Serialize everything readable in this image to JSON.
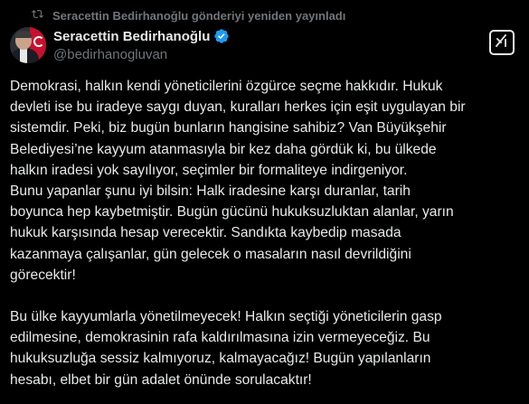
{
  "repost": {
    "icon": "repost-icon",
    "text": "Seracettin Bedirhanoğlu gönderiyi yeniden yayınladı"
  },
  "author": {
    "display_name": "Seracettin Bedirhanoğlu",
    "handle": "@bedirhanogluvan",
    "verified_icon": "verified-badge-icon",
    "verified_color": "#1d9bf0"
  },
  "actions": {
    "grok_icon": "grok-icon"
  },
  "post": {
    "paragraph1": "Demokrasi, halkın kendi yöneticilerini özgürce seçme hakkıdır. Hukuk\ndevleti ise bu iradeye saygı duyan, kuralları herkes için eşit uygulayan bir\nsistemdir. Peki, biz bugün bunların hangisine sahibiz? Van Büyükşehir\nBelediyesi’ne kayyum atanmasıyla bir kez daha gördük ki, bu ülkede\nhalkın iradesi yok sayılıyor, seçimler bir formaliteye indirgeniyor.\nBunu yapanlar şunu iyi bilsin: Halk iradesine karşı duranlar, tarih\nboyunca hep kaybetmiştir. Bugün gücünü hukuksuzluktan alanlar, yarın\nhukuk karşısında hesap verecektir. Sandıkta kaybedip masada\nkazanmaya çalışanlar, gün gelecek o masaların nasıl devrildiğini\ngörecektir!",
    "paragraph2": "Bu ülke kayyumlarla yönetilmeyecek! Halkın seçtiği yöneticilerin gasp\nedilmesine, demokrasinin rafa kaldırılmasına izin vermeyeceğiz. Bu\nhukuksuzluğa sessiz kalmıyoruz, kalmayacağız! Bugün yapılanların\nhesabı, elbet bir gün adalet önünde sorulacaktır!"
  },
  "colors": {
    "background": "#000000",
    "text_primary": "#e7e9ea",
    "text_secondary": "#71767b",
    "accent": "#1d9bf0"
  }
}
